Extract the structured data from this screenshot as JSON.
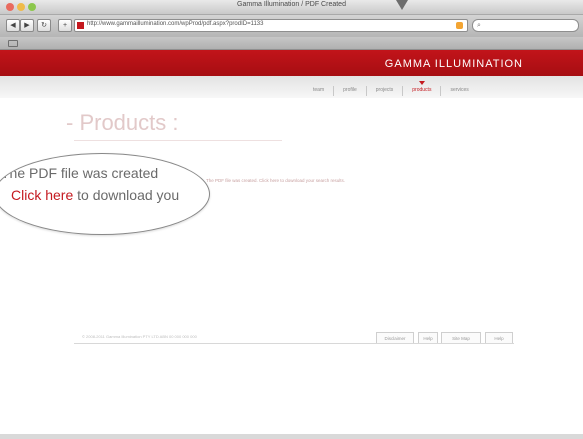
{
  "window": {
    "title": "Gamma Illumination / PDF Created",
    "url": "http://www.gammaillumination.com/wpProd/pdf.aspx?prodID=1133"
  },
  "site": {
    "brand": "GAMMA ILLUMINATION",
    "brand_color": "#c4191f",
    "nav": [
      {
        "label": "team"
      },
      {
        "label": "profile"
      },
      {
        "label": "projects"
      },
      {
        "label": "products",
        "active": true
      },
      {
        "label": "services"
      }
    ]
  },
  "content": {
    "page_title": "- Products :",
    "small_message": "The PDF file was created. Click here to download your search results.",
    "callout": {
      "line1": "The PDF file was created",
      "link": "Click here",
      "line2_rest": " to download you"
    }
  },
  "footer": {
    "copyright": "© 2008-2011 Gamma Illumination PTY LTD ABN 00 000 000 000",
    "links": [
      "Disclaimer",
      "Help",
      "Site Map",
      "Help"
    ]
  },
  "icons": {
    "back": "back-arrow-icon",
    "forward": "forward-arrow-icon",
    "reload": "reload-icon",
    "add": "add-bookmark-icon",
    "rss": "rss-icon",
    "search": "search-icon"
  }
}
